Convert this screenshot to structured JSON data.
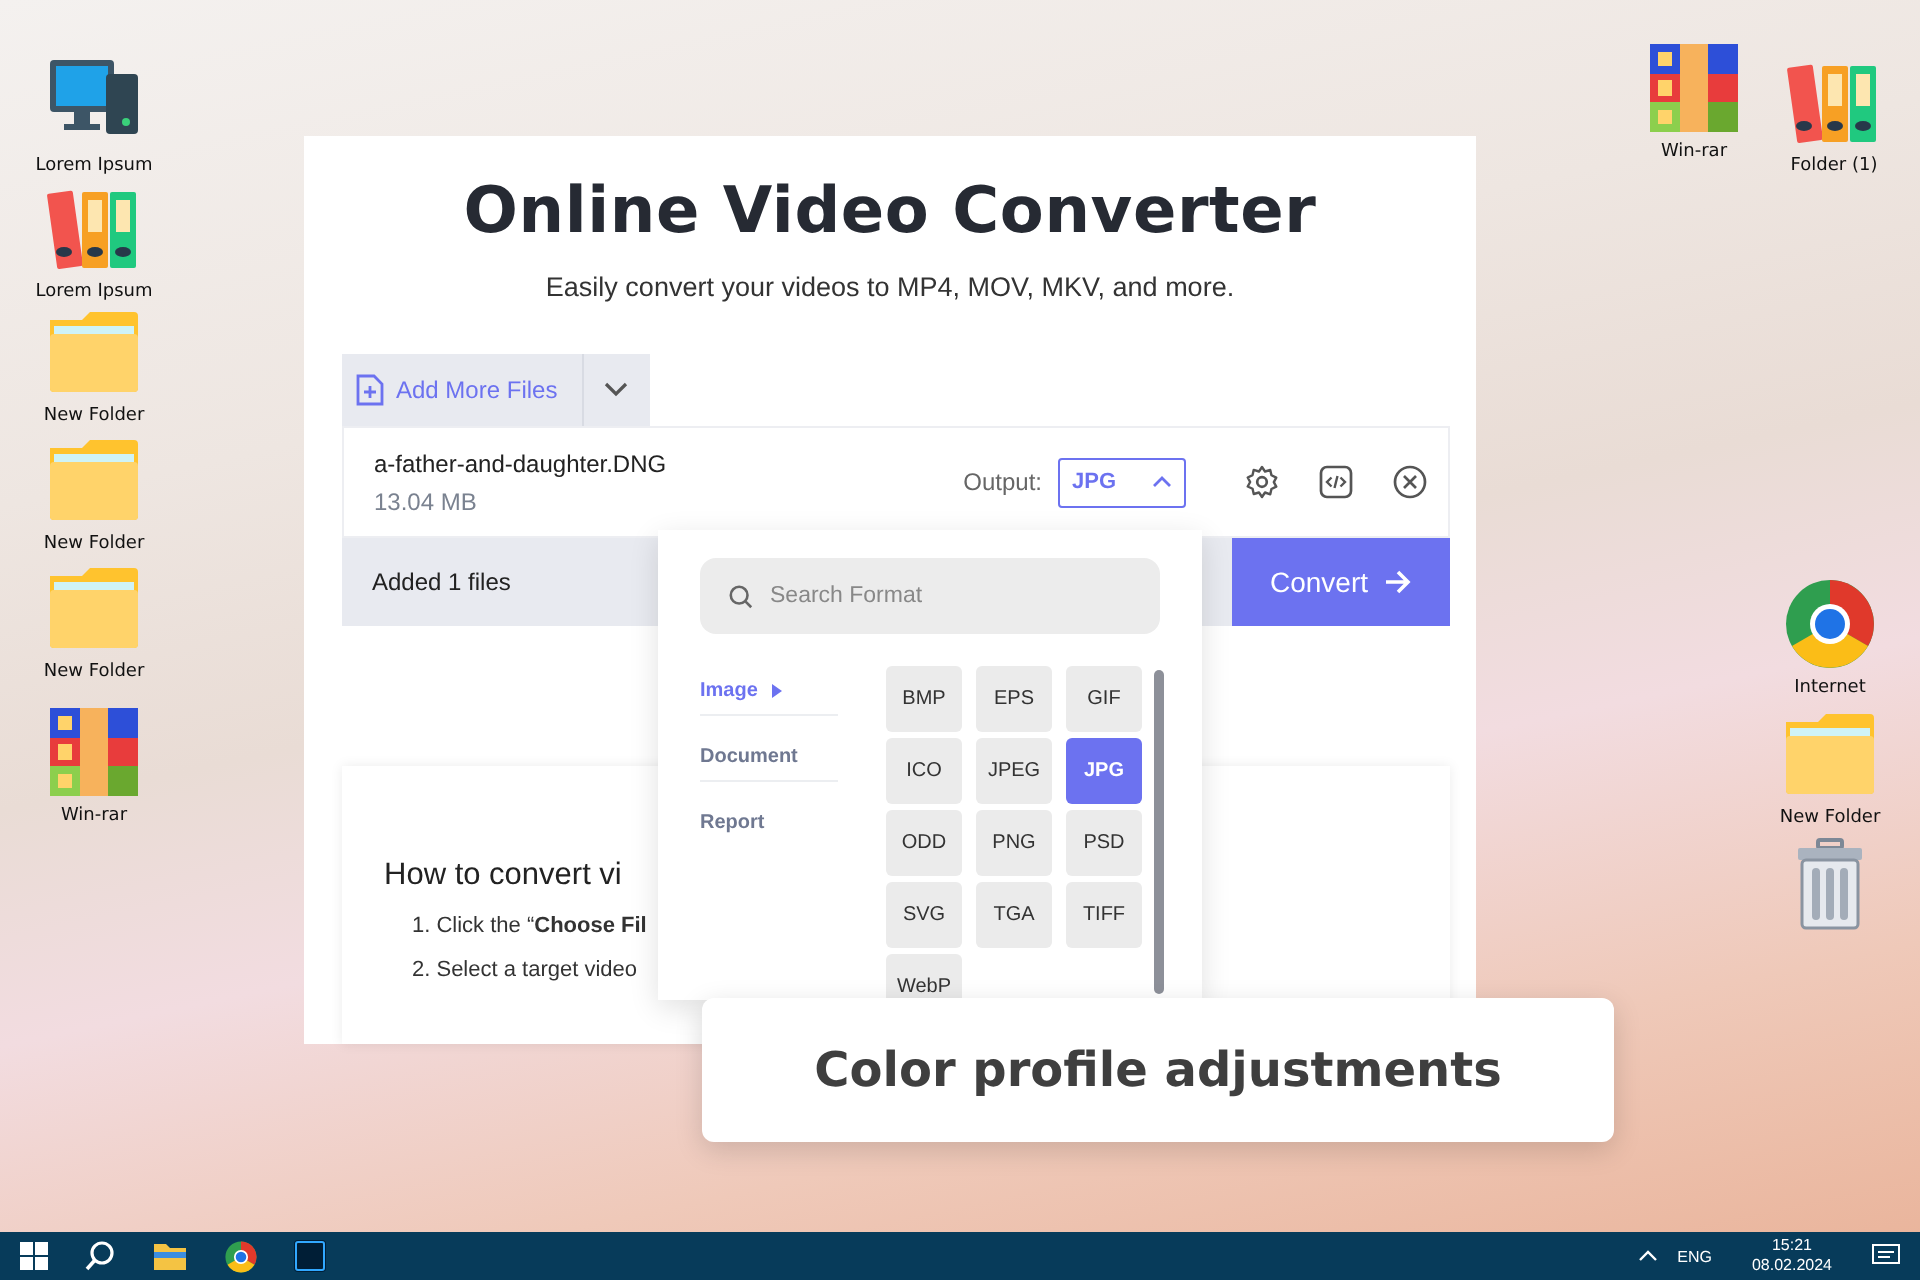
{
  "desktop": {
    "left_icons": [
      {
        "kind": "computer",
        "label": "Lorem Ipsum"
      },
      {
        "kind": "binders",
        "label": "Lorem Ipsum"
      },
      {
        "kind": "folder",
        "label": "New Folder"
      },
      {
        "kind": "folder",
        "label": "New Folder"
      },
      {
        "kind": "folder",
        "label": "New Folder"
      },
      {
        "kind": "archive",
        "label": "Win-rar"
      }
    ],
    "top_right_icons": [
      {
        "kind": "archive",
        "label": "Win-rar"
      },
      {
        "kind": "binders",
        "label": "Folder (1)"
      }
    ],
    "right_icons": [
      {
        "kind": "browser",
        "label": "Internet"
      },
      {
        "kind": "folder",
        "label": "New Folder"
      },
      {
        "kind": "trash"
      }
    ]
  },
  "converter": {
    "title": "Online Video Converter",
    "subtitle": "Easily convert your videos to MP4, MOV, MKV, and more.",
    "add_files_button": "Add More Files",
    "file": {
      "name": "a-father-and-daughter.DNG",
      "size": "13.04 MB"
    },
    "output_label": "Output:",
    "output_value": "JPG",
    "status": "Added 1 files",
    "convert_button": "Convert"
  },
  "howto": {
    "heading": "How to convert vi",
    "steps": [
      "1. Click the “**Choose Fil**",
      "2. Select a target video"
    ]
  },
  "format_menu": {
    "search": {
      "placeholder": "Search Format"
    },
    "categories": [
      {
        "label": "Image",
        "selected": true
      },
      {
        "label": "Document",
        "selected": false
      },
      {
        "label": "Report",
        "selected": false
      }
    ],
    "formats": [
      {
        "label": "BMP",
        "selected": false
      },
      {
        "label": "EPS",
        "selected": false
      },
      {
        "label": "GIF",
        "selected": false
      },
      {
        "label": "ICO",
        "selected": false
      },
      {
        "label": "JPEG",
        "selected": false
      },
      {
        "label": "JPG",
        "selected": true
      },
      {
        "label": "ODD",
        "selected": false
      },
      {
        "label": "PNG",
        "selected": false
      },
      {
        "label": "PSD",
        "selected": false
      },
      {
        "label": "SVG",
        "selected": false
      },
      {
        "label": "TGA",
        "selected": false
      },
      {
        "label": "TIFF",
        "selected": false
      },
      {
        "label": "WebP",
        "selected": false
      }
    ]
  },
  "caption": "Color profile adjustments",
  "taskbar": {
    "language": "ENG",
    "time": "15:21",
    "date": "08.02.2024"
  }
}
